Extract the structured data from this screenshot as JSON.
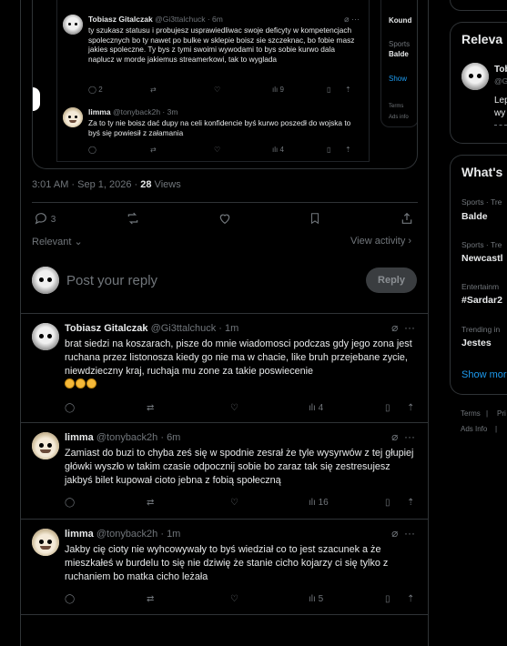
{
  "quoted": {
    "side_title": "Kound",
    "side_label1": "Sports",
    "side_value1": "Balde",
    "side_link": "Show",
    "side_terms": "Terms",
    "side_adsinfo": "Ads info",
    "post1": {
      "name": "Tobiasz Gitalczak",
      "handle": "@Gi3ttalchuck · 6m",
      "body": "ty szukasz statusu i probujesz usprawiedliwac swoje deficyty w kompetencjach spolecznych bo ty nawet po bulke w sklepie boisz sie szczeknac, bo fobie masz jakies spoleczne. Ty bys z tymi swoimi wywodami to bys sobie kurwo dala naplucz w morde jakiemus streamerkowi, tak to wyglada",
      "replies": "2",
      "views": "9"
    },
    "post2": {
      "name": "limma",
      "handle": "@tonyback2h · 3m",
      "body": "Za to ty nie boisz dać dupy na celi konfidencie byś kurwo poszedł do wojska to byś się powiesił z załamania",
      "views": "4"
    }
  },
  "meta": {
    "time": "3:01 AM · Sep 1, 2026 · ",
    "views_count": "28",
    "views_label": " Views"
  },
  "actions": {
    "replies": "3"
  },
  "sort": {
    "relevant": "Relevant",
    "view_activity": "View activity"
  },
  "reply_box": {
    "placeholder": "Post your reply",
    "button": "Reply"
  },
  "replies": [
    {
      "name": "Tobiasz Gitalczak",
      "handle": "@Gi3ttalchuck · 1m",
      "body": "brat siedzi na koszarach, pisze do mnie wiadomosci podczas gdy jego zona jest ruchana przez listonosza kiedy go nie ma w chacie, like bruh przejebane zycie, niewdzieczny kraj, ruchaja mu zone za takie poswiecenie",
      "views": "4"
    },
    {
      "name": "limma",
      "handle": "@tonyback2h · 6m",
      "body": "Zamiast do buzi to chyba ześ się w  spodnie  zesrał że tyle wysyrwów z tej głupiej główki wyszło w takim czasie odpocznij sobie bo zaraz tak się zestresujesz jakbyś bilet kupował cioto jebna z fobią społeczną",
      "views": "16"
    },
    {
      "name": "limma",
      "handle": "@tonyback2h · 1m",
      "body": "Jakby cię cioty nie wyhcowywały to byś wiedział co to jest szacunek a że mieszkałeś w burdelu to się nie dziwię że stanie cicho kojarzy ci się tylko z ruchaniem bo matka cicho leżała",
      "views": "5"
    }
  ],
  "sidebar": {
    "relevant_title": "Releva",
    "relevant_name": "Tob",
    "relevant_handle": "@G",
    "relevant_text1": "Lep",
    "relevant_text2": "wy",
    "whats_title": "What's",
    "trends": [
      {
        "category": "Sports · Tre",
        "name": "Balde"
      },
      {
        "category": "Sports · Tre",
        "name": "Newcastl"
      },
      {
        "category": "Entertainm",
        "name": "#Sardar2"
      },
      {
        "category": "Trending in",
        "name": "Jestes"
      }
    ],
    "show_more": "Show mor",
    "terms": "Terms",
    "privacy": "Pri",
    "ads": "Ads Info"
  }
}
